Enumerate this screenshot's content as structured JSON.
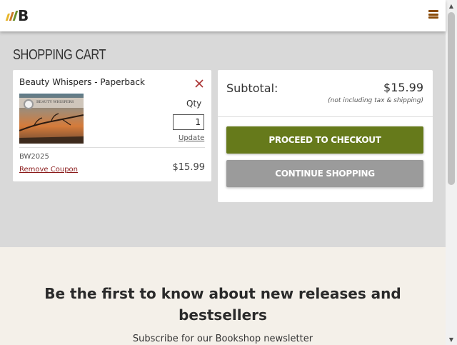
{
  "header": {
    "logo_letter": "B",
    "logo_stripe_colors": [
      "#e7b62a",
      "#c97a26",
      "#6b8f2b"
    ],
    "menu_color": "#8a4b08"
  },
  "cart": {
    "title": "SHOPPING CART",
    "item": {
      "title": "Beauty Whispers - Paperback",
      "cover_text": "BEAUTY WHISPERS",
      "qty_label": "Qty",
      "qty_value": "1",
      "update_label": "Update",
      "coupon_code": "BW2025",
      "remove_coupon_label": "Remove Coupon",
      "price": "$15.99"
    },
    "summary": {
      "subtotal_label": "Subtotal:",
      "subtotal_value": "$15.99",
      "tax_note": "(not including tax & shipping)",
      "checkout_label": "PROCEED TO CHECKOUT",
      "continue_label": "CONTINUE SHOPPING"
    }
  },
  "newsletter": {
    "title": "Be the first to know about new releases and bestsellers",
    "subtitle": "Subscribe for our Bookshop newsletter"
  },
  "colors": {
    "accent_green": "#667a1b",
    "secondary_gray": "#9b9b9b",
    "remove_red": "#8a1a1a"
  }
}
